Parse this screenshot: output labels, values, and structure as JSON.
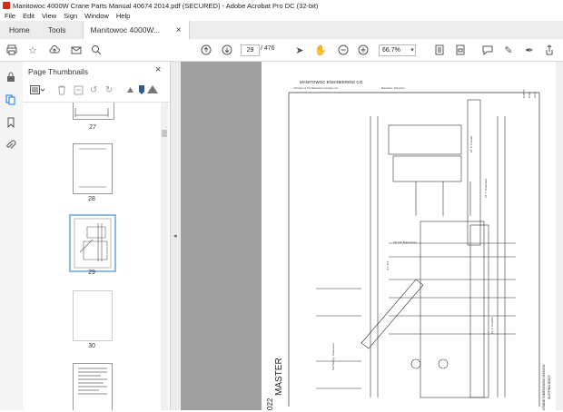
{
  "window": {
    "title": "Manitowoc 4000W Crane Parts Manual 40674 2014.pdf (SECURED) - Adobe Acrobat Pro DC (32-bit)"
  },
  "menu": [
    "File",
    "Edit",
    "View",
    "Sign",
    "Window",
    "Help"
  ],
  "tabs": {
    "home": "Home",
    "tools": "Tools",
    "document": "Manitowoc 4000W...",
    "close": "×"
  },
  "toolbar": {
    "current_page": "29",
    "total_pages": "/ 476",
    "zoom": "66.7%"
  },
  "panel": {
    "title": "Page Thumbnails",
    "close": "×",
    "thumbnails": [
      {
        "label": "27"
      },
      {
        "label": "28"
      },
      {
        "label": "29",
        "selected": true
      },
      {
        "label": "30"
      }
    ]
  },
  "document": {
    "header_company": "MANITOWOC ENGINEERING CO.",
    "header_sub": "A Division of The Manitowoc Company, Inc.",
    "header_place": "Manitowoc, Wisconsin",
    "stamp": "MASTER",
    "caption": "SLIPPING BOOT",
    "sheet_label": "CRANE DIMENSIONS M4000W",
    "page_code": "022"
  },
  "colors": {
    "accent": "#1a73e8",
    "selected_thumb": "#8eb7e8",
    "doc_background": "#a0a0a0"
  }
}
